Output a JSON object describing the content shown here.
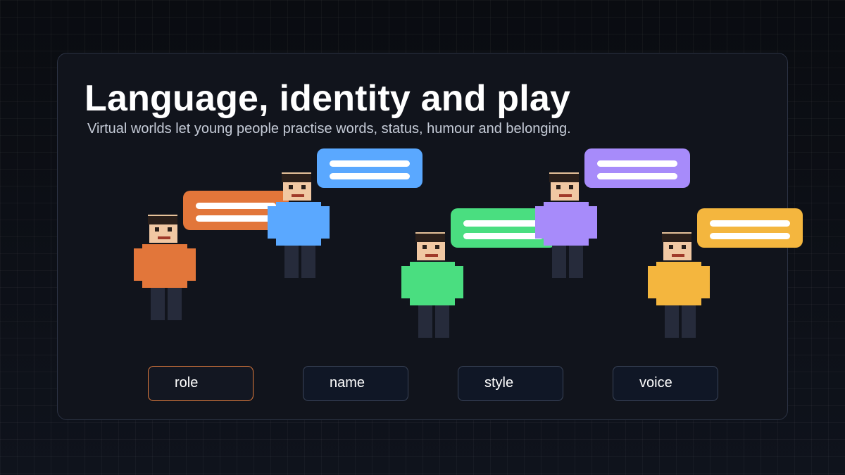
{
  "slide": {
    "title": "Language, identity and play",
    "subtitle": "Virtual worlds let young people practise words, status, humour and belonging."
  },
  "characters": [
    {
      "shirt_color": "#e2763a",
      "bubble_color": "#e2763a"
    },
    {
      "shirt_color": "#5aa8ff",
      "bubble_color": "#5aa8ff"
    },
    {
      "shirt_color": "#4ade80",
      "bubble_color": "#4ade80"
    },
    {
      "shirt_color": "#a78bfa",
      "bubble_color": "#a78bfa"
    },
    {
      "shirt_color": "#f4b63e",
      "bubble_color": "#f4b63e"
    }
  ],
  "chips": [
    {
      "label": "role",
      "active": true
    },
    {
      "label": "name",
      "active": false
    },
    {
      "label": "style",
      "active": false
    },
    {
      "label": "voice",
      "active": false
    }
  ],
  "colors": {
    "background": "#0d1017",
    "card": "#11141c",
    "active_border": "#e07b3c",
    "hair": "#2a1f1a",
    "skin": "#f1c8a3",
    "trousers": "#262b3b"
  }
}
